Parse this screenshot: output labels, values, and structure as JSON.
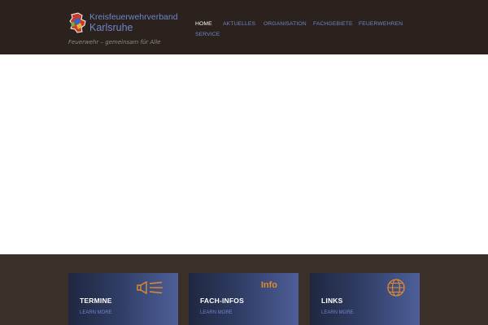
{
  "header": {
    "brand_line1": "Kreisfeuerwehrverband",
    "brand_line2": "Karlsruhe",
    "tagline": "Feuerwehr – gemeinsam für Alle",
    "nav": [
      {
        "label": "HOME",
        "active": true
      },
      {
        "label": "AKTUELLES"
      },
      {
        "label": "ORGANISATION"
      },
      {
        "label": "FACHGEBIETE"
      },
      {
        "label": "FEUERWEHREN"
      },
      {
        "label": "SERVICE"
      }
    ]
  },
  "cards": [
    {
      "title": "TERMINE",
      "more": "LEARN MORE",
      "icon": "megaphone-icon"
    },
    {
      "title": "FACH-INFOS",
      "more": "LEARN MORE",
      "icon": "info-icon",
      "icon_text": "Info"
    },
    {
      "title": "LINKS",
      "more": "LEARN MORE",
      "icon": "globe-icon"
    }
  ],
  "colors": {
    "header_bg": "#2b211d",
    "band_bg": "#3b2f2a",
    "nav_link": "#6f86c9",
    "accent_orange": "#e48a2a"
  }
}
